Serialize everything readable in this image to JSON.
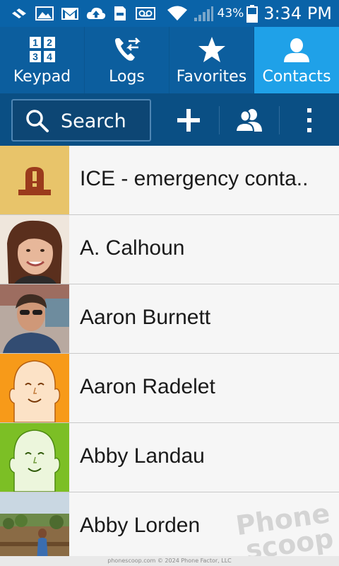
{
  "status_bar": {
    "battery_percent": "43%",
    "time": "3:34 PM",
    "icons": [
      "sync-off-icon",
      "gallery-icon",
      "gmail-icon",
      "upload-icon",
      "sd-card-icon",
      "voicemail-icon",
      "wifi-icon",
      "signal-icon",
      "battery-icon"
    ]
  },
  "tabs": [
    {
      "label": "Keypad",
      "icon": "keypad-icon",
      "active": false
    },
    {
      "label": "Logs",
      "icon": "logs-icon",
      "active": false
    },
    {
      "label": "Favorites",
      "icon": "star-icon",
      "active": false
    },
    {
      "label": "Contacts",
      "icon": "contact-icon",
      "active": true
    }
  ],
  "actionbar": {
    "search_label": "Search",
    "buttons": [
      "add-icon",
      "groups-icon",
      "overflow-menu-icon"
    ]
  },
  "contacts": [
    {
      "name": "ICE - emergency conta..",
      "avatar": "emergency-icon"
    },
    {
      "name": "A. Calhoun",
      "avatar": "photo"
    },
    {
      "name": "Aaron Burnett",
      "avatar": "photo"
    },
    {
      "name": "Aaron Radelet",
      "avatar": "default-face-orange"
    },
    {
      "name": "Abby Landau",
      "avatar": "default-face-green"
    },
    {
      "name": "Abby Lorden",
      "avatar": "photo"
    }
  ],
  "watermark": {
    "line1": "Phone",
    "line2": "scoop"
  },
  "footer": "phonescoop.com  © 2024 Phone Factor, LLC",
  "colors": {
    "status_bar": "#0a63a8",
    "tab_bar": "#0c5e9e",
    "tab_active": "#1fa1e8",
    "action_bar": "#0a4f84",
    "ice_bg": "#e8c46a",
    "ice_icon": "#9b3b1c",
    "face_orange": "#f79a19",
    "face_green": "#7cbf25"
  }
}
